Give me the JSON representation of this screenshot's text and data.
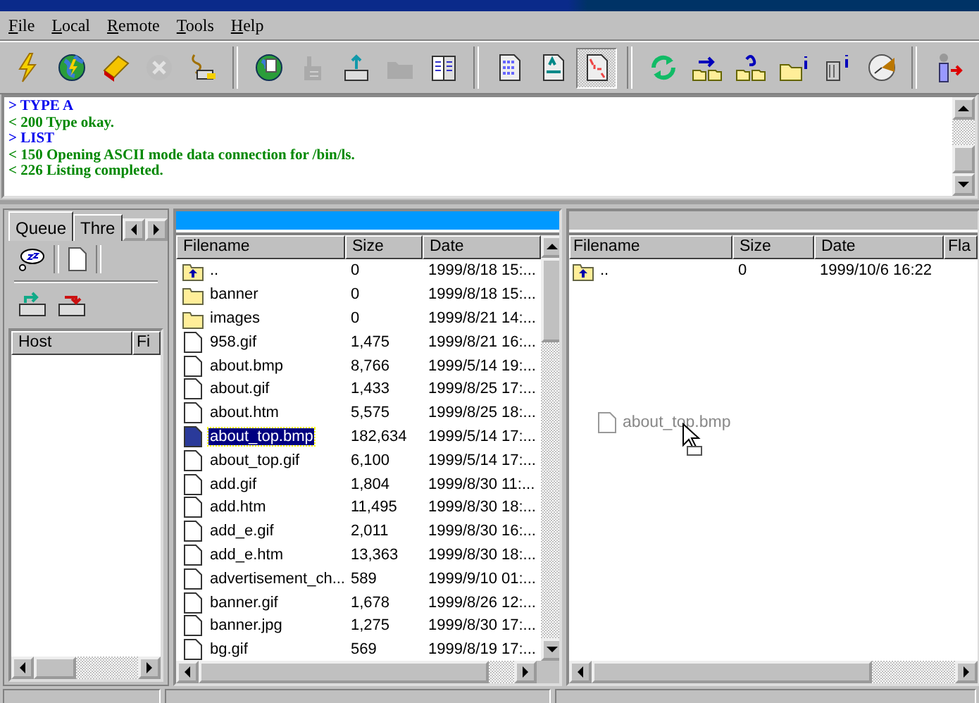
{
  "menu": [
    "File",
    "Local",
    "Remote",
    "Tools",
    "Help"
  ],
  "toolbar": [
    [
      {
        "disabled": false,
        "pressed": false
      },
      {
        "disabled": false,
        "pressed": false
      },
      {
        "disabled": false,
        "pressed": false
      },
      {
        "disabled": true,
        "pressed": false
      },
      {
        "disabled": false,
        "pressed": false
      }
    ],
    [
      {
        "disabled": false,
        "pressed": false
      },
      {
        "disabled": true,
        "pressed": false
      },
      {
        "disabled": false,
        "pressed": false
      },
      {
        "disabled": true,
        "pressed": false
      },
      {
        "disabled": false,
        "pressed": false
      }
    ],
    [
      {
        "disabled": false,
        "pressed": false
      },
      {
        "disabled": false,
        "pressed": false
      },
      {
        "disabled": false,
        "pressed": true
      }
    ],
    [
      {
        "disabled": false,
        "pressed": false
      },
      {
        "disabled": false,
        "pressed": false
      },
      {
        "disabled": false,
        "pressed": false
      },
      {
        "disabled": false,
        "pressed": false
      },
      {
        "disabled": false,
        "pressed": false
      },
      {
        "disabled": false,
        "pressed": false
      }
    ],
    [
      {
        "disabled": false,
        "pressed": false
      }
    ]
  ],
  "log": [
    {
      "kind": "command",
      "text": "> TYPE A"
    },
    {
      "kind": "reply",
      "text": "< 200 Type okay."
    },
    {
      "kind": "command",
      "text": "> LIST"
    },
    {
      "kind": "reply",
      "text": "< 150 Opening ASCII mode data connection for /bin/ls."
    },
    {
      "kind": "reply",
      "text": "< 226 Listing completed."
    }
  ],
  "queue": {
    "tabs": [
      {
        "label": "Queue",
        "selected": true
      },
      {
        "label": "Thre",
        "selected": false
      }
    ],
    "columns": [
      "Host",
      "Fi"
    ]
  },
  "local": {
    "columns": [
      "Filename",
      "Size",
      "Date"
    ],
    "rows": [
      {
        "kind": "parent",
        "name": "..",
        "size": "0",
        "date": "1999/8/18  15:...",
        "selected": false
      },
      {
        "kind": "folder",
        "name": "banner",
        "size": "0",
        "date": "1999/8/18  15:...",
        "selected": false
      },
      {
        "kind": "folder",
        "name": "images",
        "size": "0",
        "date": "1999/8/21  14:...",
        "selected": false
      },
      {
        "kind": "file",
        "name": "958.gif",
        "size": "1,475",
        "date": "1999/8/21  16:...",
        "selected": false
      },
      {
        "kind": "file",
        "name": "about.bmp",
        "size": "8,766",
        "date": "1999/5/14  19:...",
        "selected": false
      },
      {
        "kind": "file",
        "name": "about.gif",
        "size": "1,433",
        "date": "1999/8/25  17:...",
        "selected": false
      },
      {
        "kind": "file",
        "name": "about.htm",
        "size": "5,575",
        "date": "1999/8/25  18:...",
        "selected": false
      },
      {
        "kind": "file",
        "name": "about_top.bmp",
        "size": "182,634",
        "date": "1999/5/14  17:...",
        "selected": true
      },
      {
        "kind": "file",
        "name": "about_top.gif",
        "size": "6,100",
        "date": "1999/5/14  17:...",
        "selected": false
      },
      {
        "kind": "file",
        "name": "add.gif",
        "size": "1,804",
        "date": "1999/8/30  11:...",
        "selected": false
      },
      {
        "kind": "file",
        "name": "add.htm",
        "size": "11,495",
        "date": "1999/8/30  18:...",
        "selected": false
      },
      {
        "kind": "file",
        "name": "add_e.gif",
        "size": "2,011",
        "date": "1999/8/30  16:...",
        "selected": false
      },
      {
        "kind": "file",
        "name": "add_e.htm",
        "size": "13,363",
        "date": "1999/8/30  18:...",
        "selected": false
      },
      {
        "kind": "file",
        "name": "advertisement_ch...",
        "size": "589",
        "date": "1999/9/10  01:...",
        "selected": false
      },
      {
        "kind": "file",
        "name": "banner.gif",
        "size": "1,678",
        "date": "1999/8/26  12:...",
        "selected": false
      },
      {
        "kind": "file",
        "name": "banner.jpg",
        "size": "1,275",
        "date": "1999/8/30  17:...",
        "selected": false
      },
      {
        "kind": "file",
        "name": "bg.gif",
        "size": "569",
        "date": "1999/8/19  17:...",
        "selected": false
      }
    ]
  },
  "remote": {
    "columns": [
      "Filename",
      "Size",
      "Date",
      "Fla"
    ],
    "rows": [
      {
        "kind": "parent",
        "name": "..",
        "size": "0",
        "date": "1999/10/6  16:22",
        "selected": false
      }
    ],
    "drag_item": "about_top.bmp"
  }
}
